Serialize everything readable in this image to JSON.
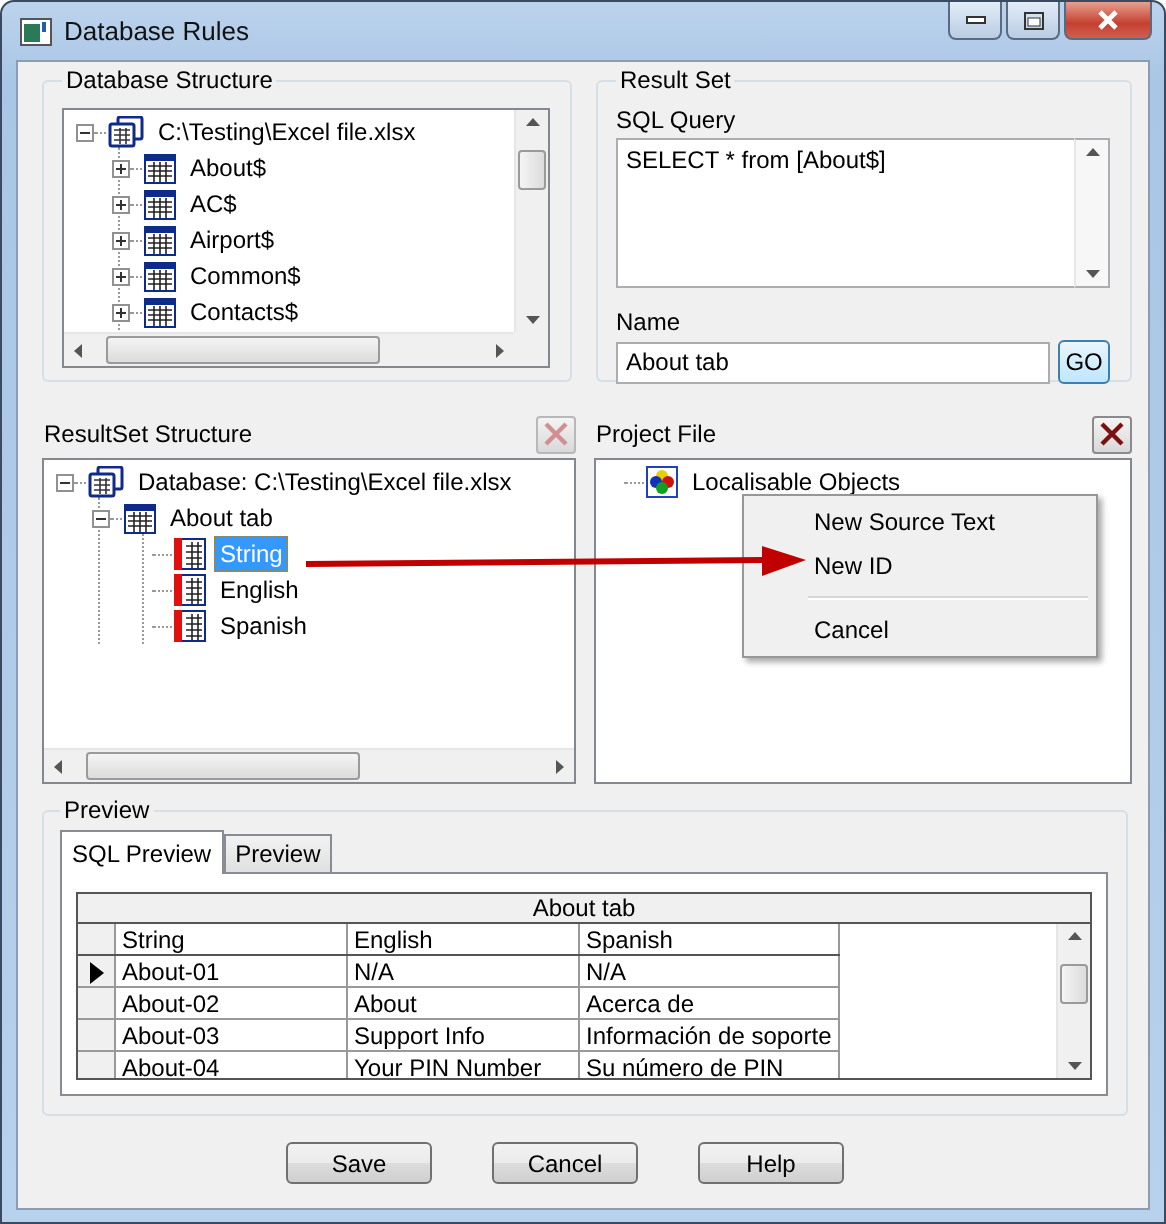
{
  "window": {
    "title": "Database Rules"
  },
  "database_structure": {
    "title": "Database Structure",
    "tree": [
      {
        "kind": "file",
        "label": "C:\\Testing\\Excel file.xlsx",
        "expanded": true,
        "children": [
          {
            "kind": "sheet",
            "label": "About$",
            "expanded": false
          },
          {
            "kind": "sheet",
            "label": "AC$",
            "expanded": false
          },
          {
            "kind": "sheet",
            "label": "Airport$",
            "expanded": false
          },
          {
            "kind": "sheet",
            "label": "Common$",
            "expanded": false
          },
          {
            "kind": "sheet",
            "label": "Contacts$",
            "expanded": false
          }
        ]
      }
    ]
  },
  "result_set": {
    "title": "Result Set",
    "query_label": "SQL Query",
    "query": "SELECT * from [About$]",
    "name_label": "Name",
    "name": "About tab",
    "go_button": "GO"
  },
  "resultset_structure": {
    "title": "ResultSet Structure",
    "delete_disabled": true,
    "tree": [
      {
        "kind": "file",
        "label": "Database: C:\\Testing\\Excel file.xlsx",
        "expanded": true,
        "children": [
          {
            "kind": "sheet",
            "label": "About tab",
            "expanded": true,
            "children": [
              {
                "kind": "column",
                "label": "String",
                "selected": true
              },
              {
                "kind": "column",
                "label": "English",
                "selected": false
              },
              {
                "kind": "column",
                "label": "Spanish",
                "selected": false
              }
            ]
          }
        ]
      }
    ]
  },
  "project_file": {
    "title": "Project File",
    "delete_disabled": false,
    "tree": [
      {
        "kind": "objects",
        "label": "Localisable Objects"
      }
    ]
  },
  "context_menu": [
    {
      "kind": "item",
      "label": "New Source Text"
    },
    {
      "kind": "item",
      "label": "New ID"
    },
    {
      "kind": "separator"
    },
    {
      "kind": "item",
      "label": "Cancel"
    }
  ],
  "preview": {
    "title": "Preview",
    "tabs": [
      {
        "label": "SQL Preview",
        "selected": true
      },
      {
        "label": "Preview",
        "selected": false
      }
    ],
    "grid": {
      "caption": "About tab",
      "columns": [
        "String",
        "English",
        "Spanish"
      ],
      "rows": [
        {
          "current": true,
          "cells": [
            "About-01",
            "N/A",
            "N/A"
          ]
        },
        {
          "current": false,
          "cells": [
            "About-02",
            "About",
            "Acerca de"
          ]
        },
        {
          "current": false,
          "cells": [
            "About-03",
            "Support Info",
            "Información de soporte"
          ]
        },
        {
          "current": false,
          "cells": [
            "About-04",
            "Your PIN Number",
            "Su número de PIN"
          ]
        }
      ]
    }
  },
  "buttons": [
    "Save",
    "Cancel",
    "Help"
  ]
}
